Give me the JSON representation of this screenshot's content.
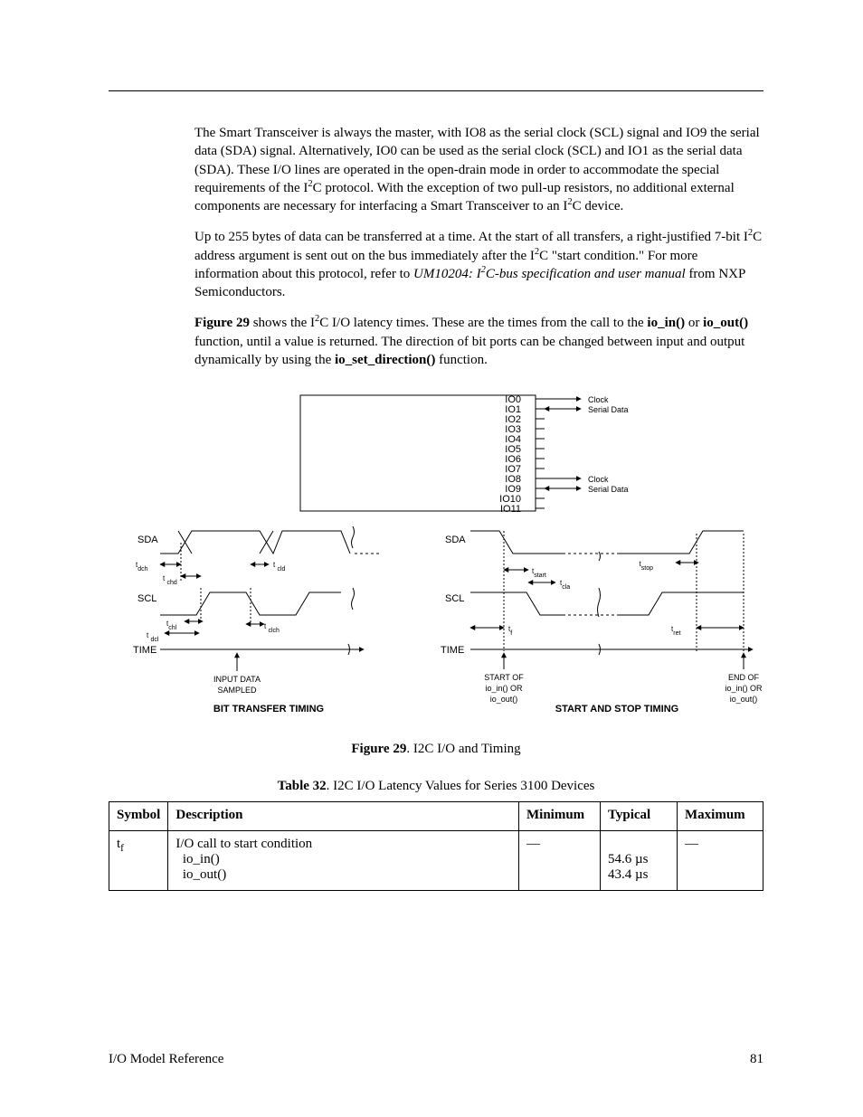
{
  "para1_parts": {
    "a": "The Smart Transceiver is always the master, with IO8 as the serial clock (SCL) signal and IO9 the serial data (SDA) signal.  Alternatively, IO0 can be used as the serial clock (SCL) and IO1 as the serial data (SDA).  These I/O lines are operated in the open-drain mode in order to accommodate the special requirements of the I",
    "b": "C protocol.  With the exception of two pull-up resistors, no additional external components are necessary for interfacing a Smart Transceiver to an I",
    "c": "C device."
  },
  "para2_parts": {
    "a": "Up to 255 bytes of data can be transferred at a time.  At the start of all transfers, a right-justified 7-bit I",
    "b": "C address argument is sent out on the bus immediately after the I",
    "c": "C \"start condition.\"  For more information about this protocol, refer to ",
    "d": "UM10204: I",
    "e": "C-bus specification and user manual",
    "f": " from NXP Semiconductors."
  },
  "para3_parts": {
    "a": "Figure 29",
    "b": " shows the I",
    "c": "C I/O latency times.  These are the times from the call to the ",
    "d": "io_in()",
    "e": " or ",
    "f": "io_out()",
    "g": " function, until a value is returned.  The direction of bit ports can be changed between input and output dynamically by using the ",
    "h": "io_set_direction()",
    "i": " function."
  },
  "figure": {
    "io_labels": [
      "IO0",
      "IO1",
      "IO2",
      "IO3",
      "IO4",
      "IO5",
      "IO6",
      "IO7",
      "IO8",
      "IO9",
      "IO10",
      "IO11"
    ],
    "clock": "Clock",
    "serial_data": "Serial Data",
    "SDA": "SDA",
    "SCL": "SCL",
    "TIME": "TIME",
    "t_dch": "dch",
    "t_chd": "chd",
    "t_cld": "cld",
    "t_chl": "chl",
    "t_dcl": "dcl",
    "t_clch": "clch",
    "t_start": "start",
    "t_cla": "cla",
    "t_stop": "stop",
    "t_ret": "ret",
    "t_f": "f",
    "input_sampled_1": "INPUT DATA",
    "input_sampled_2": "SAMPLED",
    "start_of": "START OF",
    "end_of": "END OF",
    "io_in_or": "io_in() OR",
    "io_out": "io_out()",
    "bit_transfer": "BIT TRANSFER TIMING",
    "start_stop": "START AND STOP TIMING"
  },
  "figure_caption": {
    "label": "Figure 29",
    "text": ". I2C I/O and Timing"
  },
  "table_caption": {
    "label": "Table 32",
    "text": ". I2C I/O Latency Values for Series 3100 Devices"
  },
  "table": {
    "headers": {
      "symbol": "Symbol",
      "description": "Description",
      "minimum": "Minimum",
      "typical": "Typical",
      "maximum": "Maximum"
    },
    "row": {
      "symbol_main": "t",
      "symbol_sub": "f",
      "desc_l1": "I/O call to start condition",
      "desc_l2": "io_in()",
      "desc_l3": "io_out()",
      "min": "—",
      "typ_l1": "54.6 µs",
      "typ_l2": "43.4 µs",
      "max": "—"
    }
  },
  "footer": {
    "title": "I/O Model Reference",
    "page": "81"
  }
}
